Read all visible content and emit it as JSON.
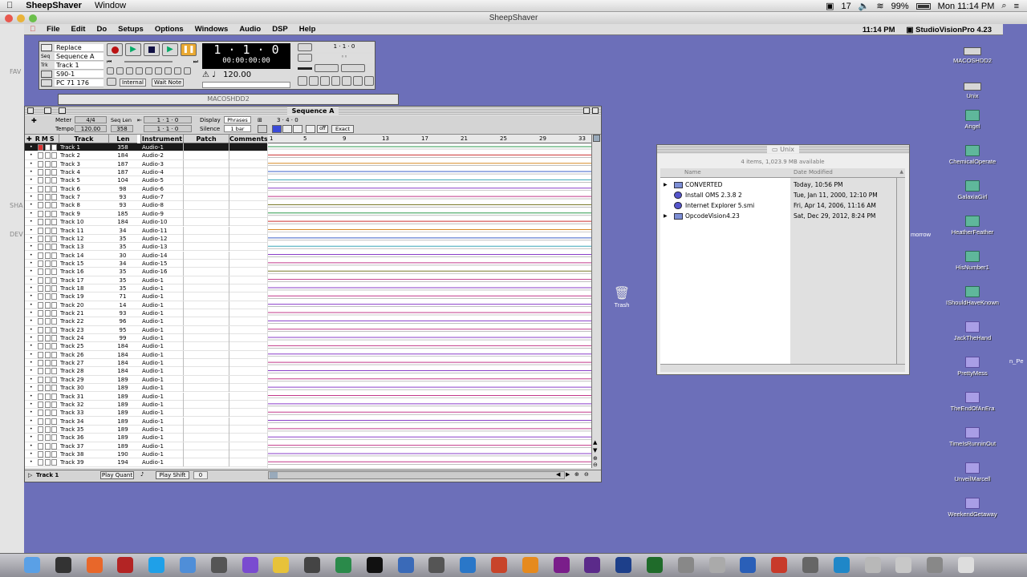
{
  "host": {
    "app_name": "SheepShaver",
    "menus": [
      "Window"
    ],
    "battery": "99%",
    "battery_level": 0.99,
    "status_num": "17",
    "clock": "Mon 11:14 PM",
    "window_title": "SheepShaver"
  },
  "mac": {
    "menus": [
      "File",
      "Edit",
      "Do",
      "Setups",
      "Options",
      "Windows",
      "Audio",
      "DSP",
      "Help"
    ],
    "time": "11:14 PM",
    "app": "StudioVisionPro 4.23"
  },
  "transport": {
    "rows": [
      {
        "tag": "",
        "value": "Replace"
      },
      {
        "tag": "Seq",
        "value": "Sequence A"
      },
      {
        "tag": "Trk",
        "value": "Track 1"
      },
      {
        "tag": "",
        "value": "S90-1"
      },
      {
        "tag": "",
        "value": "PC   71    176"
      }
    ],
    "counter": "1 · 1 · 0",
    "time": "00:00:00:00",
    "tempo": "120.00",
    "sync": "Internal",
    "wait": "Wait Note",
    "punch_in": "1 · 1 · 0",
    "punch_mid": "◦◦",
    "punch_out": "◦◦"
  },
  "drive_window_title": "MACOSHDD2",
  "sequence": {
    "title": "Sequence A",
    "meter_label": "Meter",
    "meter": "4/4",
    "seqlen_label": "Seq Len",
    "seqlen": "358",
    "tempo_label": "Tempo",
    "tempo": "120.00",
    "pos1": "1 · 1 · 0",
    "pos2": "1 · 1 · 0",
    "display_label": "Display",
    "display": "Phrases",
    "silence_label": "Silence",
    "silence": "1 bar",
    "grid": "3 · 4 · 0",
    "off": "off",
    "exact": "Exact",
    "headers": {
      "track": "Track",
      "len": "Len",
      "instrument": "Instrument",
      "patch": "Patch",
      "comments": "Comments"
    },
    "ruler": [
      "1",
      "5",
      "9",
      "13",
      "17",
      "21",
      "25",
      "29",
      "33"
    ],
    "tracks": [
      {
        "name": "Track 1",
        "len": "358",
        "inst": "Audio-1"
      },
      {
        "name": "Track 2",
        "len": "184",
        "inst": "Audio-2"
      },
      {
        "name": "Track 3",
        "len": "187",
        "inst": "Audio-3"
      },
      {
        "name": "Track 4",
        "len": "187",
        "inst": "Audio-4"
      },
      {
        "name": "Track 5",
        "len": "104",
        "inst": "Audio-5"
      },
      {
        "name": "Track 6",
        "len": "98",
        "inst": "Audio-6"
      },
      {
        "name": "Track 7",
        "len": "93",
        "inst": "Audio-7"
      },
      {
        "name": "Track 8",
        "len": "93",
        "inst": "Audio-8"
      },
      {
        "name": "Track 9",
        "len": "185",
        "inst": "Audio-9"
      },
      {
        "name": "Track 10",
        "len": "184",
        "inst": "Audio-10"
      },
      {
        "name": "Track 11",
        "len": "34",
        "inst": "Audio-11"
      },
      {
        "name": "Track 12",
        "len": "35",
        "inst": "Audio-12"
      },
      {
        "name": "Track 13",
        "len": "35",
        "inst": "Audio-13"
      },
      {
        "name": "Track 14",
        "len": "30",
        "inst": "Audio-14"
      },
      {
        "name": "Track 15",
        "len": "34",
        "inst": "Audio-15"
      },
      {
        "name": "Track 16",
        "len": "35",
        "inst": "Audio-16"
      },
      {
        "name": "Track 17",
        "len": "35",
        "inst": "Audio-1"
      },
      {
        "name": "Track 18",
        "len": "35",
        "inst": "Audio-1"
      },
      {
        "name": "Track 19",
        "len": "71",
        "inst": "Audio-1"
      },
      {
        "name": "Track 20",
        "len": "14",
        "inst": "Audio-1"
      },
      {
        "name": "Track 21",
        "len": "93",
        "inst": "Audio-1"
      },
      {
        "name": "Track 22",
        "len": "96",
        "inst": "Audio-1"
      },
      {
        "name": "Track 23",
        "len": "95",
        "inst": "Audio-1"
      },
      {
        "name": "Track 24",
        "len": "99",
        "inst": "Audio-1"
      },
      {
        "name": "Track 25",
        "len": "184",
        "inst": "Audio-1"
      },
      {
        "name": "Track 26",
        "len": "184",
        "inst": "Audio-1"
      },
      {
        "name": "Track 27",
        "len": "184",
        "inst": "Audio-1"
      },
      {
        "name": "Track 28",
        "len": "184",
        "inst": "Audio-1"
      },
      {
        "name": "Track 29",
        "len": "189",
        "inst": "Audio-1"
      },
      {
        "name": "Track 30",
        "len": "189",
        "inst": "Audio-1"
      },
      {
        "name": "Track 31",
        "len": "189",
        "inst": "Audio-1"
      },
      {
        "name": "Track 32",
        "len": "189",
        "inst": "Audio-1"
      },
      {
        "name": "Track 33",
        "len": "189",
        "inst": "Audio-1"
      },
      {
        "name": "Track 34",
        "len": "189",
        "inst": "Audio-1"
      },
      {
        "name": "Track 35",
        "len": "189",
        "inst": "Audio-1"
      },
      {
        "name": "Track 36",
        "len": "189",
        "inst": "Audio-1"
      },
      {
        "name": "Track 37",
        "len": "189",
        "inst": "Audio-1"
      },
      {
        "name": "Track 38",
        "len": "190",
        "inst": "Audio-1"
      },
      {
        "name": "Track 39",
        "len": "194",
        "inst": "Audio-1"
      }
    ],
    "footer_track": "Track 1",
    "play_quant": "Play Quant",
    "play_shift": "Play Shift",
    "shift_value": "0"
  },
  "unix": {
    "title": "Unix",
    "info": "4 items, 1,023.9 MB available",
    "col_name": "Name",
    "col_date": "Date Modified",
    "files": [
      {
        "name": "CONVERTED",
        "date": "Today, 10:56 PM",
        "kind": "folder"
      },
      {
        "name": "Install OMS 2.3.8  2",
        "date": "Tue, Jan 11, 2000, 12:10 PM",
        "kind": "app"
      },
      {
        "name": "Internet Explorer 5.smi",
        "date": "Fri, Apr 14, 2006, 11:16 AM",
        "kind": "app"
      },
      {
        "name": "OpcodeVision4.23",
        "date": "Sat, Dec 29, 2012, 8:24 PM",
        "kind": "folder"
      }
    ]
  },
  "desktop": {
    "icons": [
      {
        "label": "MACOSHDD2",
        "kind": "disk"
      },
      {
        "label": "Unix",
        "kind": "disk"
      },
      {
        "label": "Angel",
        "kind": "folder"
      },
      {
        "label": "ChemicalOperate",
        "kind": "folder"
      },
      {
        "label": "GalaxiaGirl",
        "kind": "folder"
      },
      {
        "label": "HeatherFeather",
        "kind": "folder"
      },
      {
        "label": "HisNumber1",
        "kind": "folder"
      },
      {
        "label": "IShouldHaveKnown",
        "kind": "folder"
      },
      {
        "label": "JackTheHand",
        "kind": "purple"
      },
      {
        "label": "PrettyMess",
        "kind": "purple"
      },
      {
        "label": "TheEndOfAnEra",
        "kind": "purple"
      },
      {
        "label": "TimeIsRunninOut",
        "kind": "purple"
      },
      {
        "label": "UnveilMarcell",
        "kind": "purple"
      },
      {
        "label": "WeekendGetaway",
        "kind": "purple"
      }
    ],
    "stray_label": "morrow",
    "edge_label": "n_Pe",
    "trash": "Trash"
  },
  "left_strip": [
    "FAV",
    "SHA",
    "DEV"
  ],
  "dock_apps": [
    "finder-icon",
    "piano-icon",
    "firefox-icon",
    "filezilla-icon",
    "skype-icon",
    "safari-icon",
    "app-icon",
    "logic-icon",
    "pencil-icon",
    "finalcut-icon",
    "app-icon",
    "app-icon",
    "app-icon",
    "app-icon",
    "app-icon",
    "app-icon",
    "vlc-icon",
    "premiere-icon",
    "aftereffects-icon",
    "photoshop-icon",
    "dreamweaver-icon",
    "app-icon",
    "app-icon",
    "app-icon",
    "app-icon",
    "app-icon",
    "app-icon",
    "app-icon",
    "app-icon",
    "app-icon",
    "trash-icon"
  ]
}
